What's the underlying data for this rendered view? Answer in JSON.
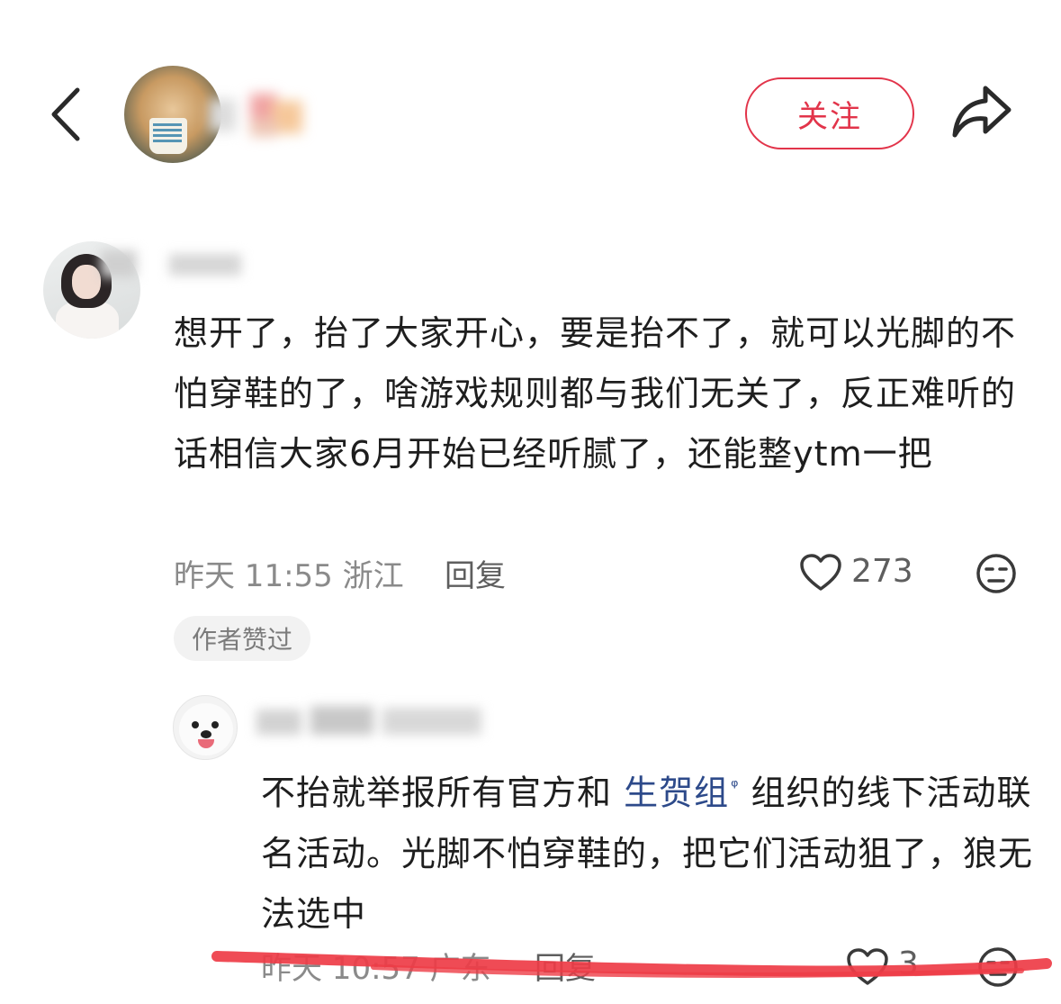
{
  "header": {
    "back_icon": "chevron-left-icon",
    "follow_label": "关注",
    "share_icon": "share-icon",
    "accent": "#e2344a"
  },
  "comment": {
    "text": "想开了，抬了大家开心，要是抬不了，就可以光脚的不怕穿鞋的了，啥游戏规则都与我们无关了，反正难听的话相信大家6月开始已经听腻了，还能整ytm一把",
    "meta": "昨天 11:55 浙江",
    "reply_label": "回复",
    "like_count": "273",
    "badge": "作者赞过"
  },
  "reply": {
    "text_before_link": "不抬就举报所有官方和 ",
    "link_text": "生贺组",
    "link_sup": "ᵠ",
    "text_after_link": " 组织的线下活动联名活动。光脚不怕穿鞋的，把它们活动狙了，狼无法选中",
    "meta": "昨天 10:57 广东",
    "reply_label": "回复",
    "like_count": "3"
  }
}
